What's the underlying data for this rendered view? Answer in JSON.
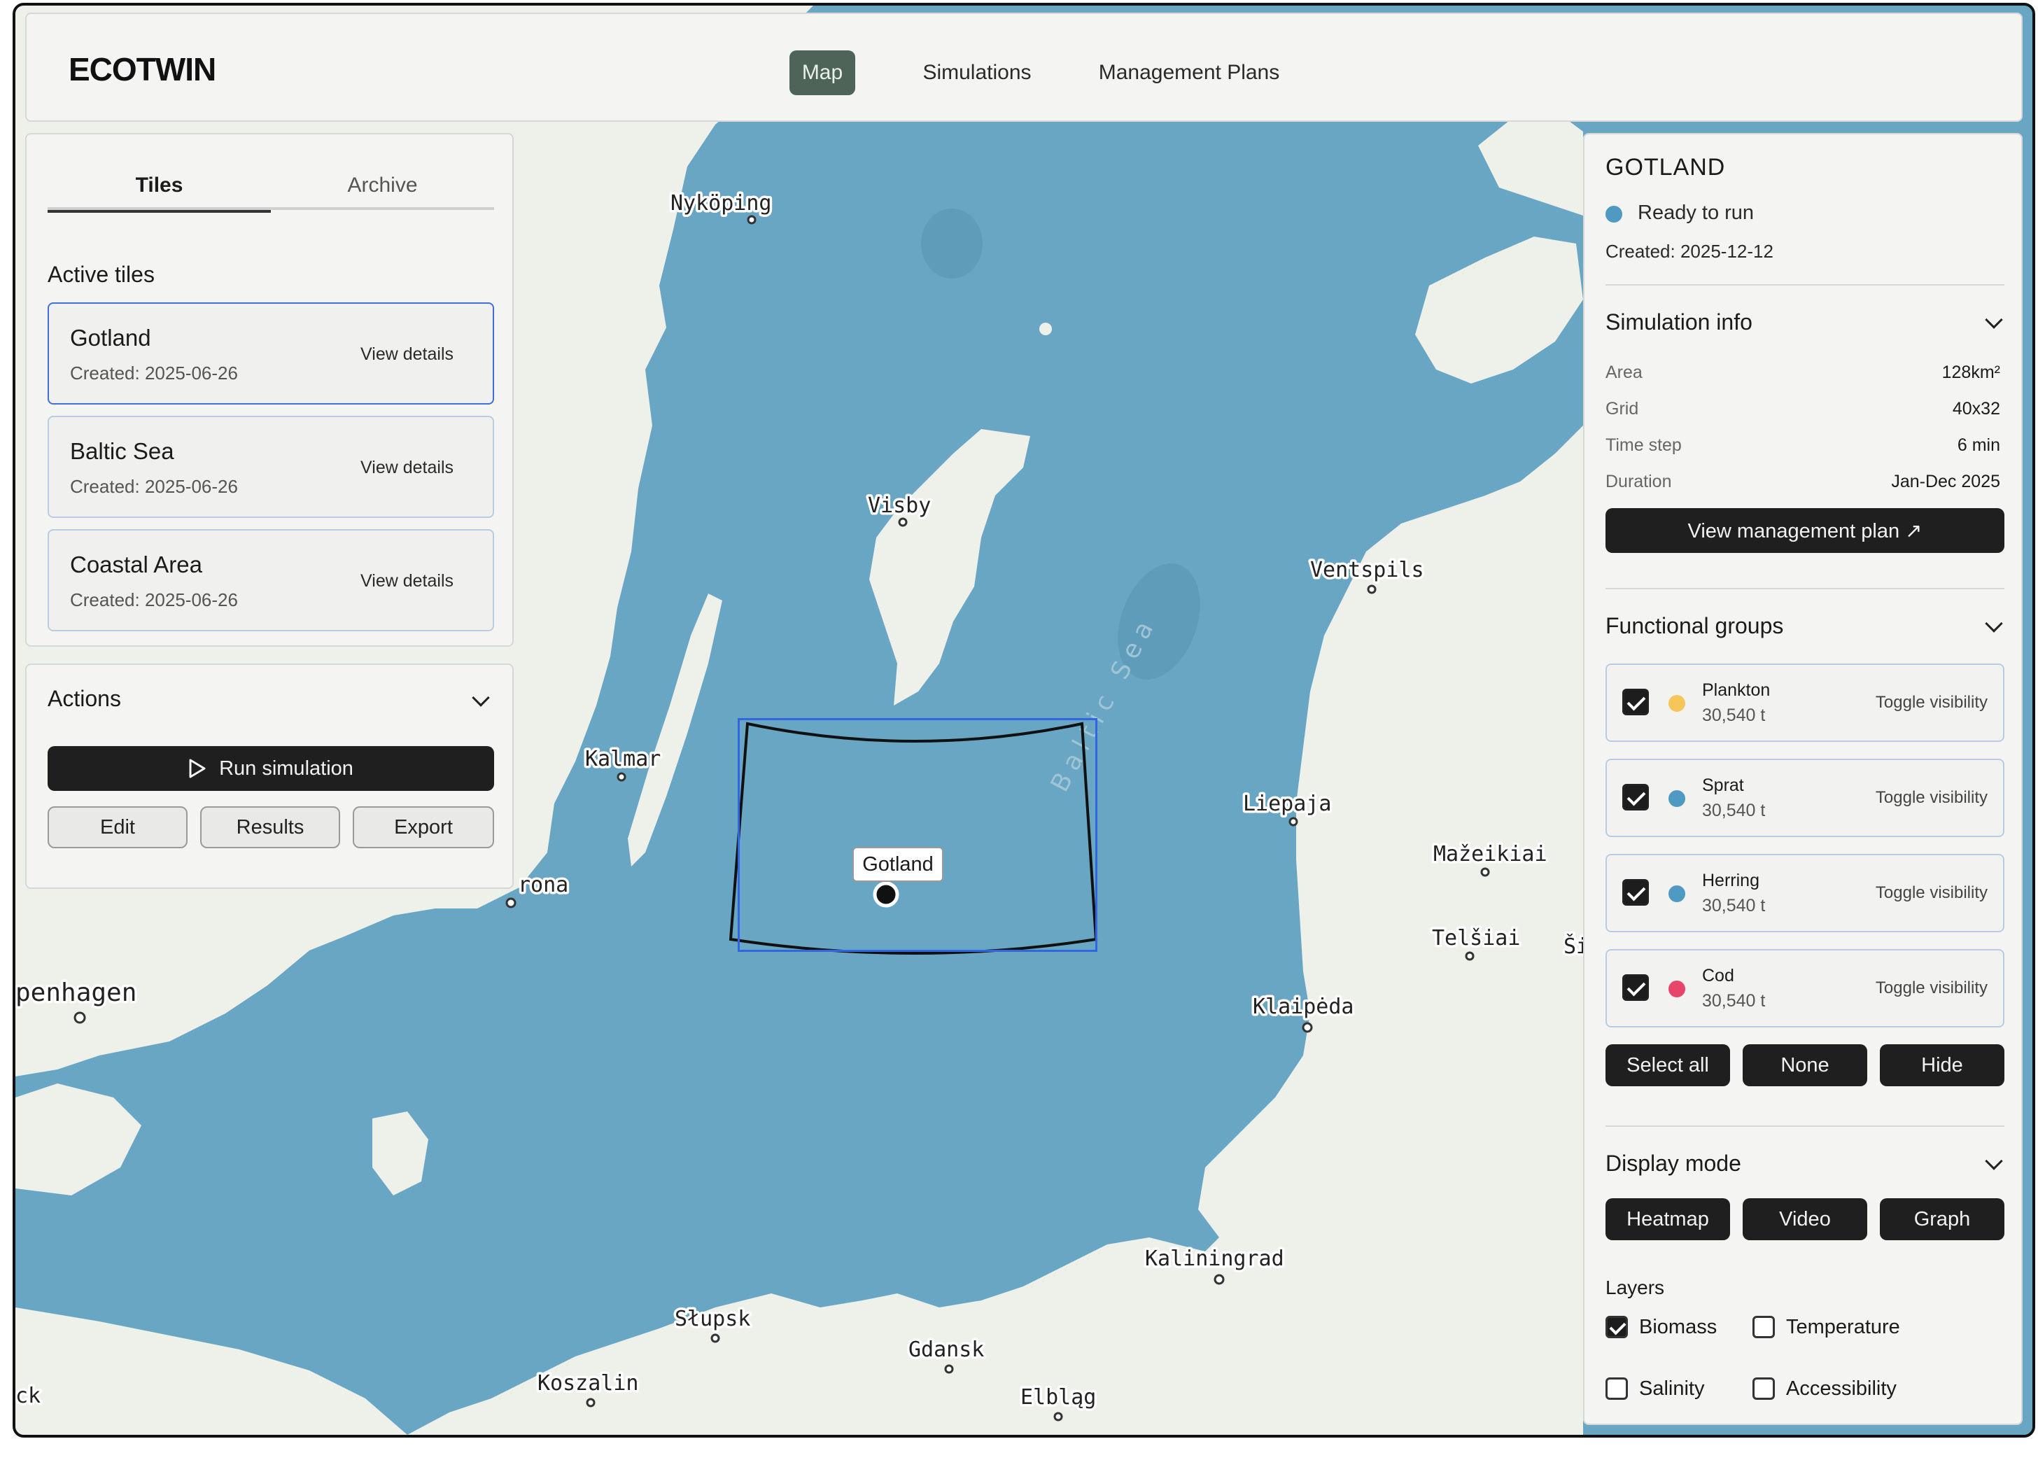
{
  "app": {
    "logo": "ECOTWIN"
  },
  "nav": [
    {
      "label": "Map",
      "active": true
    },
    {
      "label": "Simulations",
      "active": false
    },
    {
      "label": "Management Plans",
      "active": false
    }
  ],
  "tabs": {
    "tiles": "Tiles",
    "archive": "Archive"
  },
  "active_tiles": {
    "heading": "Active tiles",
    "items": [
      {
        "name": "Gotland",
        "created": "Created: 2025-06-26",
        "action": "View details",
        "selected": true
      },
      {
        "name": "Baltic Sea",
        "created": "Created: 2025-06-26",
        "action": "View details",
        "selected": false
      },
      {
        "name": "Coastal Area",
        "created": "Created: 2025-06-26",
        "action": "View details",
        "selected": false
      }
    ]
  },
  "actions": {
    "heading": "Actions",
    "run": "Run simulation",
    "edit": "Edit",
    "results": "Results",
    "export": "Export"
  },
  "map": {
    "water_color": "#68a6c3",
    "land_color": "#eef0ea",
    "selected_tile_label": "Gotland",
    "sea_label": "Baltic Sea",
    "cities": [
      "Nyköping",
      "Visby",
      "Ventspils",
      "Kalmar",
      "Liepaja",
      "Mažeikiai",
      "Telšiai",
      "Ši",
      "rona",
      "penhagen",
      "Klaipėda",
      "Kaliningrad",
      "Słupsk",
      "Gdansk",
      "Koszalin",
      "Elbląg",
      "ck"
    ]
  },
  "detail": {
    "title": "GOTLAND",
    "status": "Ready to run",
    "status_color": "#4e9ac2",
    "created": "Created: 2025-12-12",
    "sim_info": {
      "heading": "Simulation info",
      "rows": [
        {
          "label": "Area",
          "value": "128km²"
        },
        {
          "label": "Grid",
          "value": "40x32"
        },
        {
          "label": "Time step",
          "value": "6 min"
        },
        {
          "label": "Duration",
          "value": "Jan-Dec 2025"
        }
      ],
      "plan_button": "View management plan ↗"
    },
    "functional_groups": {
      "heading": "Functional groups",
      "items": [
        {
          "name": "Plankton",
          "value": "30,540 t",
          "color": "#f7c65a",
          "checked": true,
          "toggle": "Toggle visibility"
        },
        {
          "name": "Sprat",
          "value": "30,540 t",
          "color": "#4e9ac2",
          "checked": true,
          "toggle": "Toggle visibility"
        },
        {
          "name": "Herring",
          "value": "30,540 t",
          "color": "#4e9ac2",
          "checked": true,
          "toggle": "Toggle visibility"
        },
        {
          "name": "Cod",
          "value": "30,540 t",
          "color": "#e8456a",
          "checked": true,
          "toggle": "Toggle visibility"
        }
      ],
      "select_all": "Select all",
      "none": "None",
      "hide": "Hide"
    },
    "display_mode": {
      "heading": "Display mode",
      "heatmap": "Heatmap",
      "video": "Video",
      "graph": "Graph"
    },
    "layers": {
      "heading": "Layers",
      "items": [
        {
          "name": "Biomass",
          "checked": true
        },
        {
          "name": "Temperature",
          "checked": false
        },
        {
          "name": "Salinity",
          "checked": false
        },
        {
          "name": "Accessibility",
          "checked": false
        }
      ]
    }
  }
}
